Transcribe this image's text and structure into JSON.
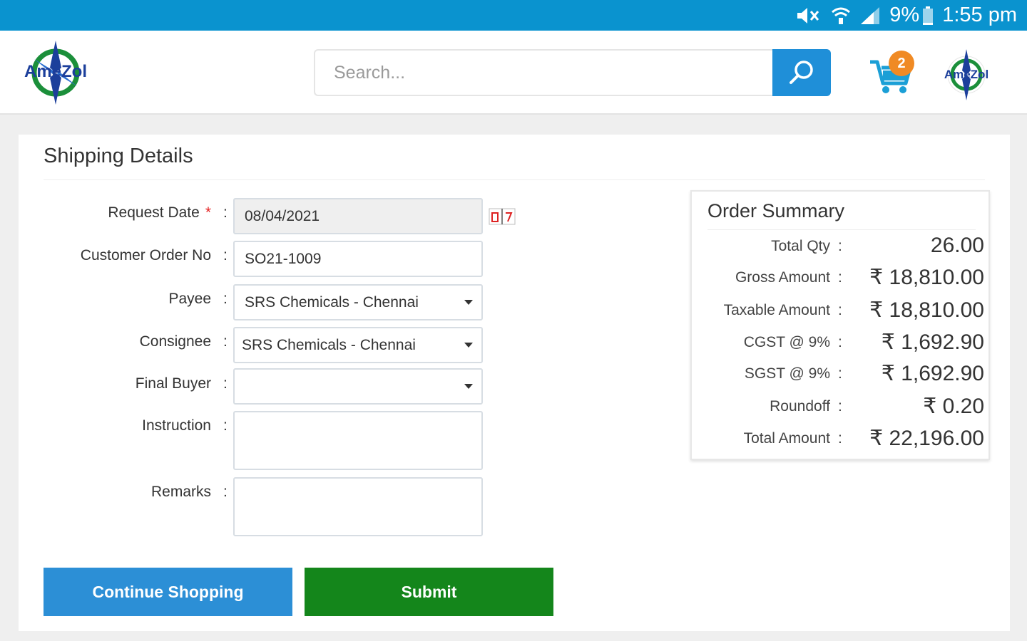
{
  "status_bar": {
    "battery": "9%",
    "time": "1:55 pm",
    "icons": [
      "mute-icon",
      "wifi-icon",
      "signal-icon",
      "battery-icon"
    ]
  },
  "header": {
    "logo_text": "AmeZol",
    "search_placeholder": "Search...",
    "cart_count": "2",
    "colors": {
      "status_bar": "#0a93cf",
      "search_button": "#1f8fd8",
      "badge": "#f08a24"
    }
  },
  "shipping": {
    "title": "Shipping Details",
    "fields": {
      "request_date": {
        "label": "Request Date",
        "value": "08/04/2021"
      },
      "customer_order_no": {
        "label": "Customer Order No",
        "value": "SO21-1009"
      },
      "payee": {
        "label": "Payee",
        "value": "SRS Chemicals - Chennai"
      },
      "consignee": {
        "label": "Consignee",
        "value": "SRS Chemicals - Chennai"
      },
      "final_buyer": {
        "label": "Final Buyer",
        "value": ""
      },
      "instruction": {
        "label": "Instruction",
        "value": ""
      },
      "remarks": {
        "label": "Remarks",
        "value": ""
      }
    },
    "required_marker": "*",
    "colon": ":"
  },
  "buttons": {
    "continue_label": "Continue Shopping",
    "submit_label": "Submit",
    "colors": {
      "continue": "#2c8fd6",
      "submit": "#14861b"
    }
  },
  "order_summary": {
    "title": "Order Summary",
    "rows": [
      {
        "label": "Total Qty",
        "value": "26.00"
      },
      {
        "label": "Gross Amount",
        "value": "₹ 18,810.00"
      },
      {
        "label": "Taxable Amount",
        "value": "₹ 18,810.00"
      },
      {
        "label": "CGST @ 9%",
        "value": "₹ 1,692.90"
      },
      {
        "label": "SGST @ 9%",
        "value": "₹ 1,692.90"
      },
      {
        "label": "Roundoff",
        "value": "₹ 0.20"
      },
      {
        "label": "Total Amount",
        "value": "₹ 22,196.00"
      }
    ]
  }
}
